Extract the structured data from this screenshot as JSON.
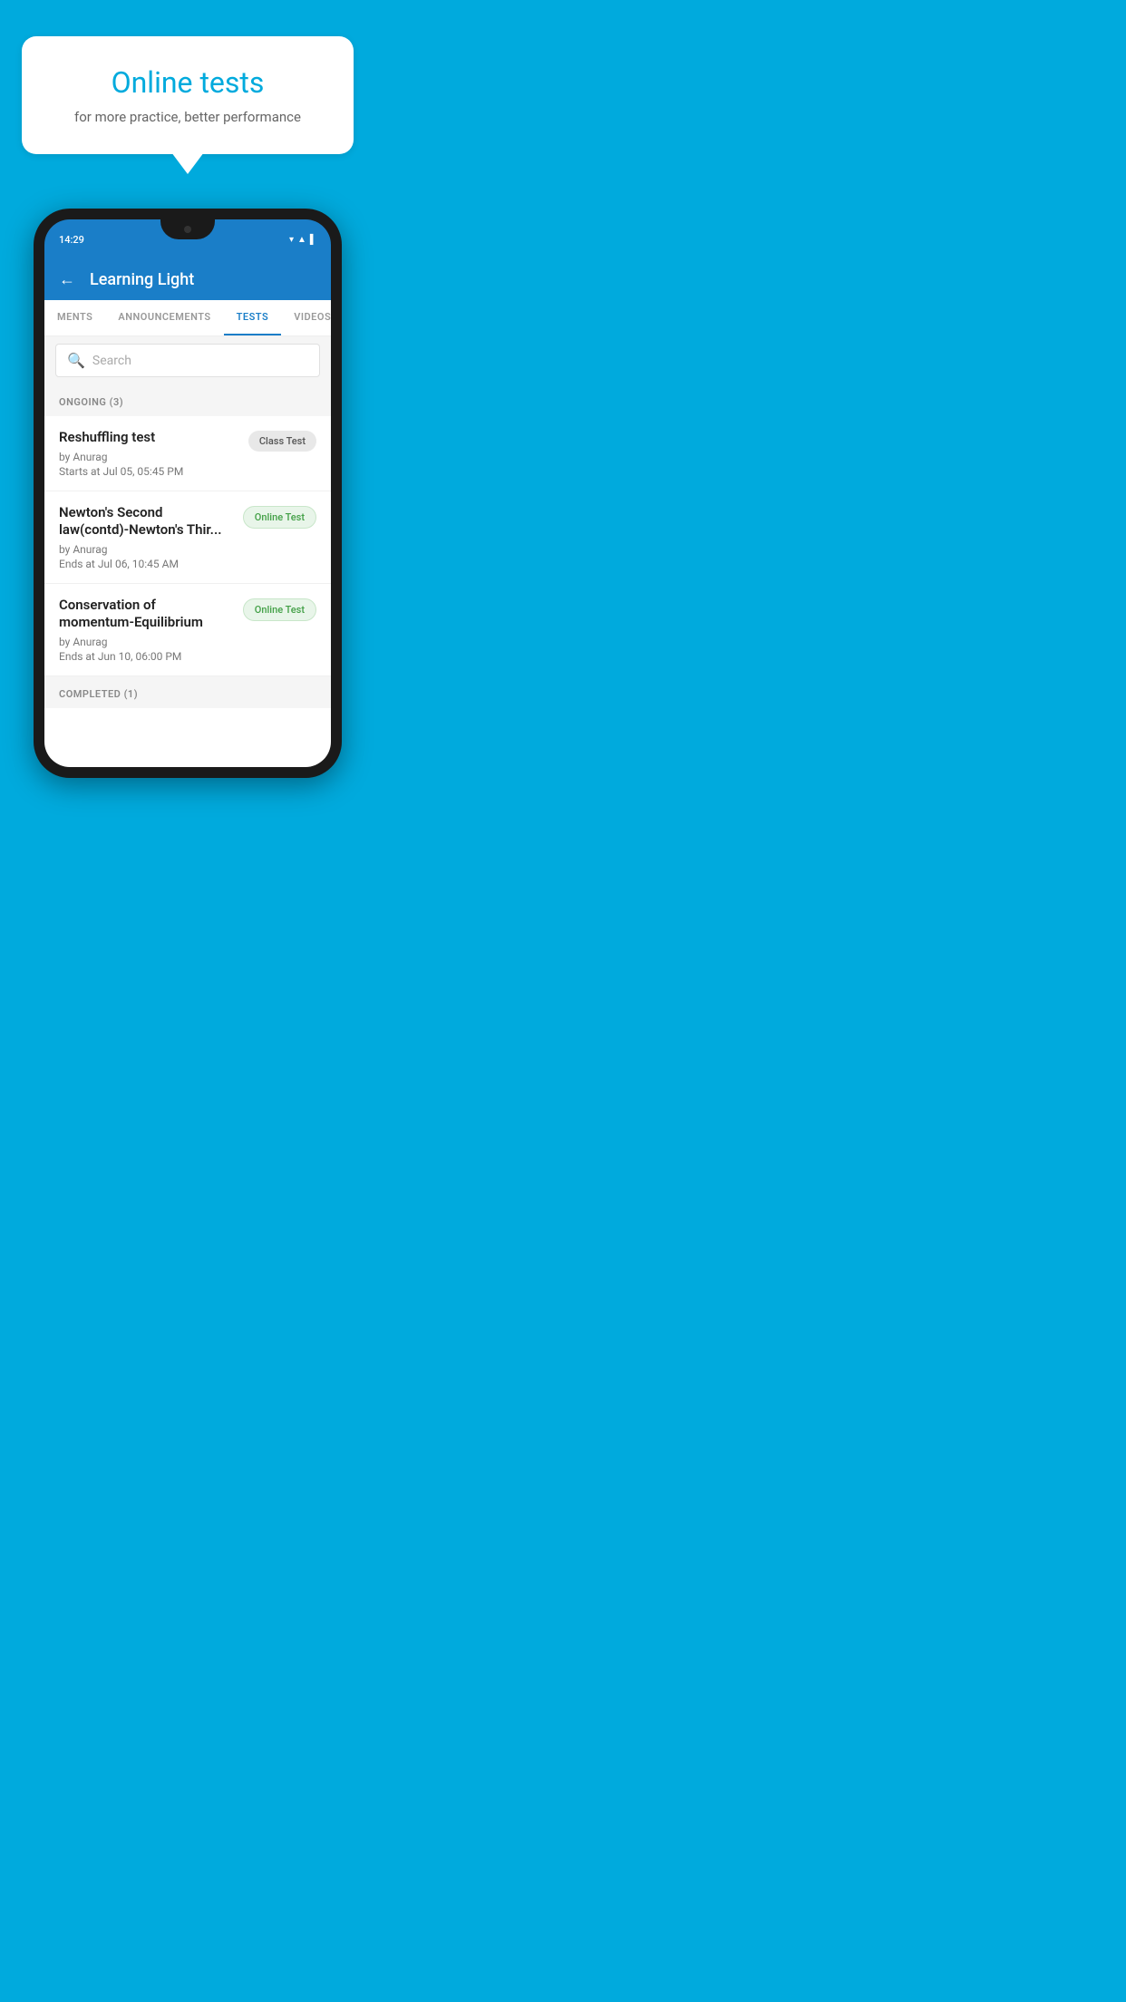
{
  "background_color": "#00AADD",
  "hero": {
    "bubble_title": "Online tests",
    "bubble_subtitle": "for more practice, better performance"
  },
  "phone": {
    "status_time": "14:29",
    "app_name": "Learning Light",
    "tabs": [
      {
        "label": "MENTS",
        "active": false
      },
      {
        "label": "ANNOUNCEMENTS",
        "active": false
      },
      {
        "label": "TESTS",
        "active": true
      },
      {
        "label": "VIDEOS",
        "active": false
      }
    ],
    "search": {
      "placeholder": "Search"
    },
    "ongoing_section": {
      "label": "ONGOING (3)",
      "tests": [
        {
          "name": "Reshuffling test",
          "author": "by Anurag",
          "date": "Starts at  Jul 05, 05:45 PM",
          "badge": "Class Test",
          "badge_type": "class"
        },
        {
          "name": "Newton's Second law(contd)-Newton's Thir...",
          "author": "by Anurag",
          "date": "Ends at  Jul 06, 10:45 AM",
          "badge": "Online Test",
          "badge_type": "online"
        },
        {
          "name": "Conservation of momentum-Equilibrium",
          "author": "by Anurag",
          "date": "Ends at  Jun 10, 06:00 PM",
          "badge": "Online Test",
          "badge_type": "online"
        }
      ]
    },
    "completed_section": {
      "label": "COMPLETED (1)"
    }
  }
}
